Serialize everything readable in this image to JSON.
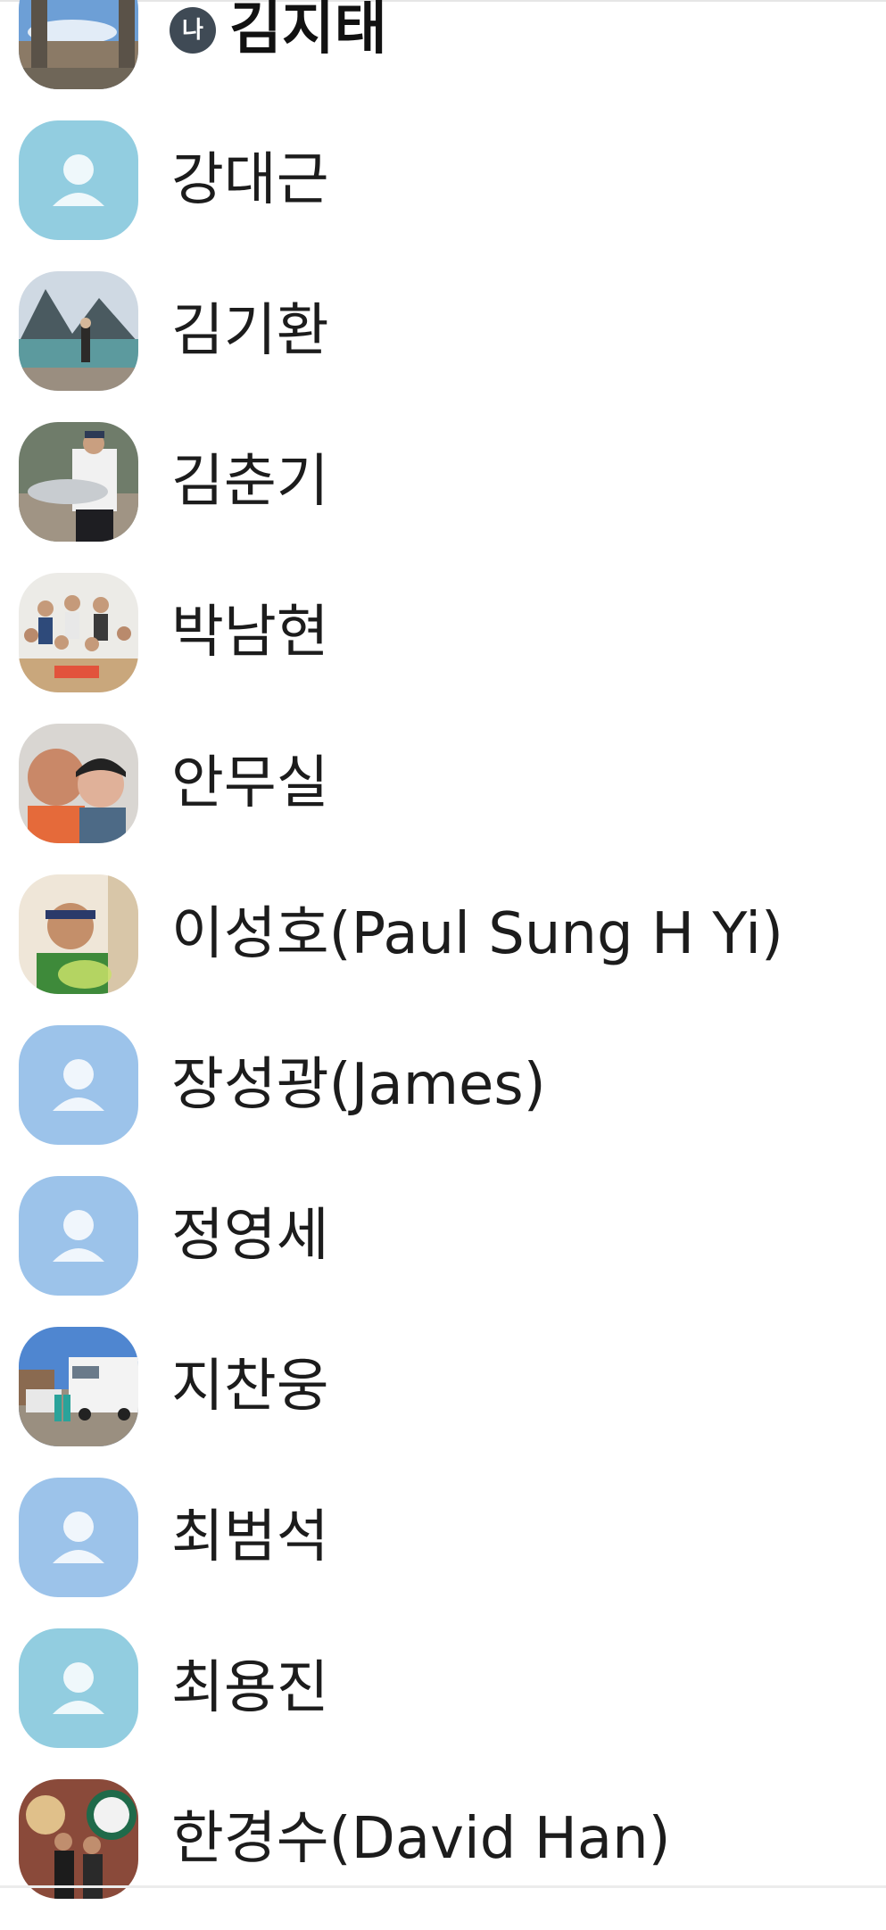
{
  "contacts": [
    {
      "name": "김지태",
      "badge": "나",
      "bold": true,
      "avatar": "photo-pillars"
    },
    {
      "name": "강대근",
      "avatar": "default-teal"
    },
    {
      "name": "김기환",
      "avatar": "photo-lake"
    },
    {
      "name": "김춘기",
      "avatar": "photo-fish"
    },
    {
      "name": "박남현",
      "avatar": "photo-family"
    },
    {
      "name": "안무실",
      "avatar": "photo-couple"
    },
    {
      "name": "이성호(Paul Sung H Yi)",
      "avatar": "photo-tennis"
    },
    {
      "name": "장성광(James)",
      "avatar": "default-blue"
    },
    {
      "name": "정영세",
      "avatar": "default-blue"
    },
    {
      "name": "지찬웅",
      "avatar": "photo-rv"
    },
    {
      "name": "최범석",
      "avatar": "default-blue"
    },
    {
      "name": "최용진",
      "avatar": "default-teal"
    },
    {
      "name": "한경수(David Han)",
      "avatar": "photo-cafe"
    }
  ],
  "colors": {
    "default_teal": "#92cde0",
    "default_blue": "#9cc3ea",
    "badge_bg": "#3f4a55",
    "text": "#1c1c1c"
  }
}
